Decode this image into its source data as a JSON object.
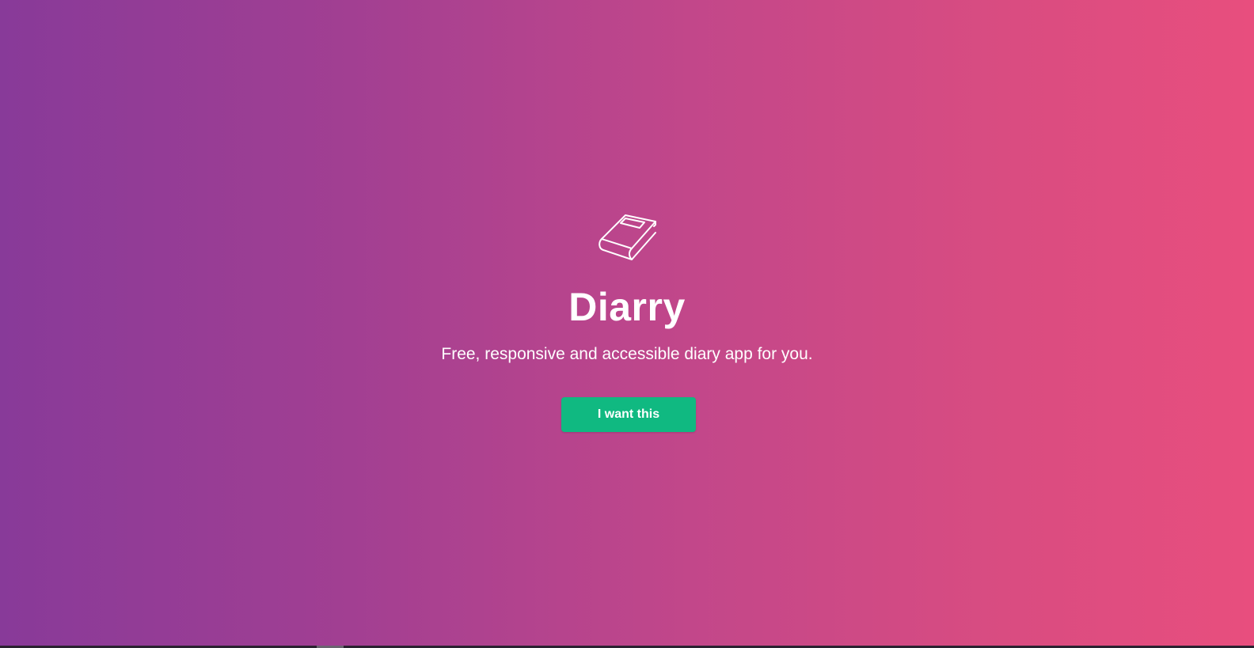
{
  "hero": {
    "logo_icon": "book-icon",
    "title": "Diarry",
    "tagline": "Free, responsive and accessible diary app for you.",
    "cta_label": "I want this"
  },
  "colors": {
    "gradient_start": "#883a99",
    "gradient_end": "#e84e7e",
    "cta_background": "#10b981",
    "text": "#ffffff"
  }
}
